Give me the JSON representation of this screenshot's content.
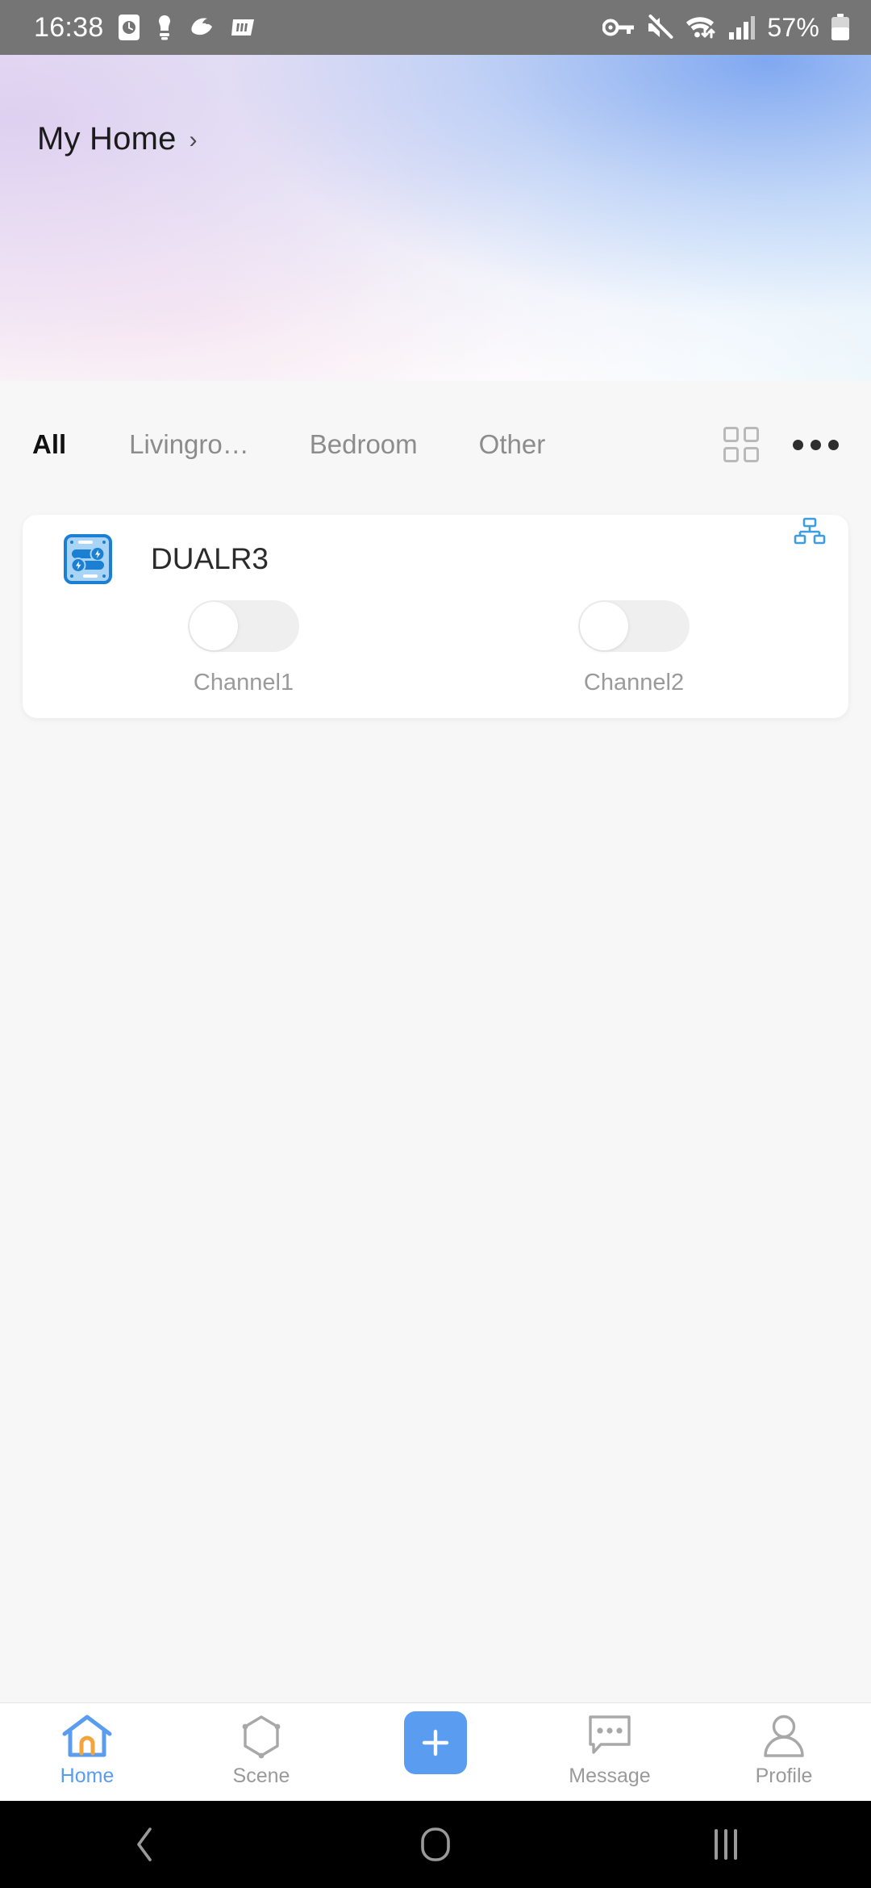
{
  "status_bar": {
    "time": "16:38",
    "battery_percent": "57%",
    "left_icons": [
      "clock-icon",
      "app-notification-icon",
      "app-notification-icon-2",
      "app-notification-icon-3"
    ],
    "right_icons": [
      "vpn-key-icon",
      "mute-icon",
      "wifi-icon",
      "signal-icon",
      "battery-icon"
    ]
  },
  "header": {
    "home_name": "My Home",
    "chevron": "›"
  },
  "tabs": {
    "items": [
      {
        "label": "All",
        "active": true
      },
      {
        "label": "Livingro…",
        "active": false
      },
      {
        "label": "Bedroom",
        "active": false
      },
      {
        "label": "Other",
        "active": false
      }
    ],
    "actions": [
      "grid-view-icon",
      "more-options-icon"
    ]
  },
  "device_card": {
    "name": "DUALR3",
    "device_icon": "dual-relay-icon",
    "connection_icon": "lan-network-icon",
    "channels": [
      {
        "label": "Channel1",
        "state": "off"
      },
      {
        "label": "Channel2",
        "state": "off"
      }
    ]
  },
  "bottom_nav": {
    "items": [
      {
        "label": "Home",
        "icon": "home-icon",
        "active": true
      },
      {
        "label": "Scene",
        "icon": "scene-hexagon-icon",
        "active": false
      },
      {
        "label": "",
        "icon": "add-plus-icon",
        "active": false
      },
      {
        "label": "Message",
        "icon": "message-bubble-icon",
        "active": false
      },
      {
        "label": "Profile",
        "icon": "profile-person-icon",
        "active": false
      }
    ]
  },
  "android_nav": {
    "items": [
      "back-icon",
      "home-circle-icon",
      "recents-icon"
    ]
  },
  "colors": {
    "accent": "#5a9cf0",
    "device_icon_blue": "#1b7fd4",
    "status_bar_bg": "#757575",
    "page_bg": "#f7f7f7",
    "home_icon_orange": "#f5a43c"
  }
}
